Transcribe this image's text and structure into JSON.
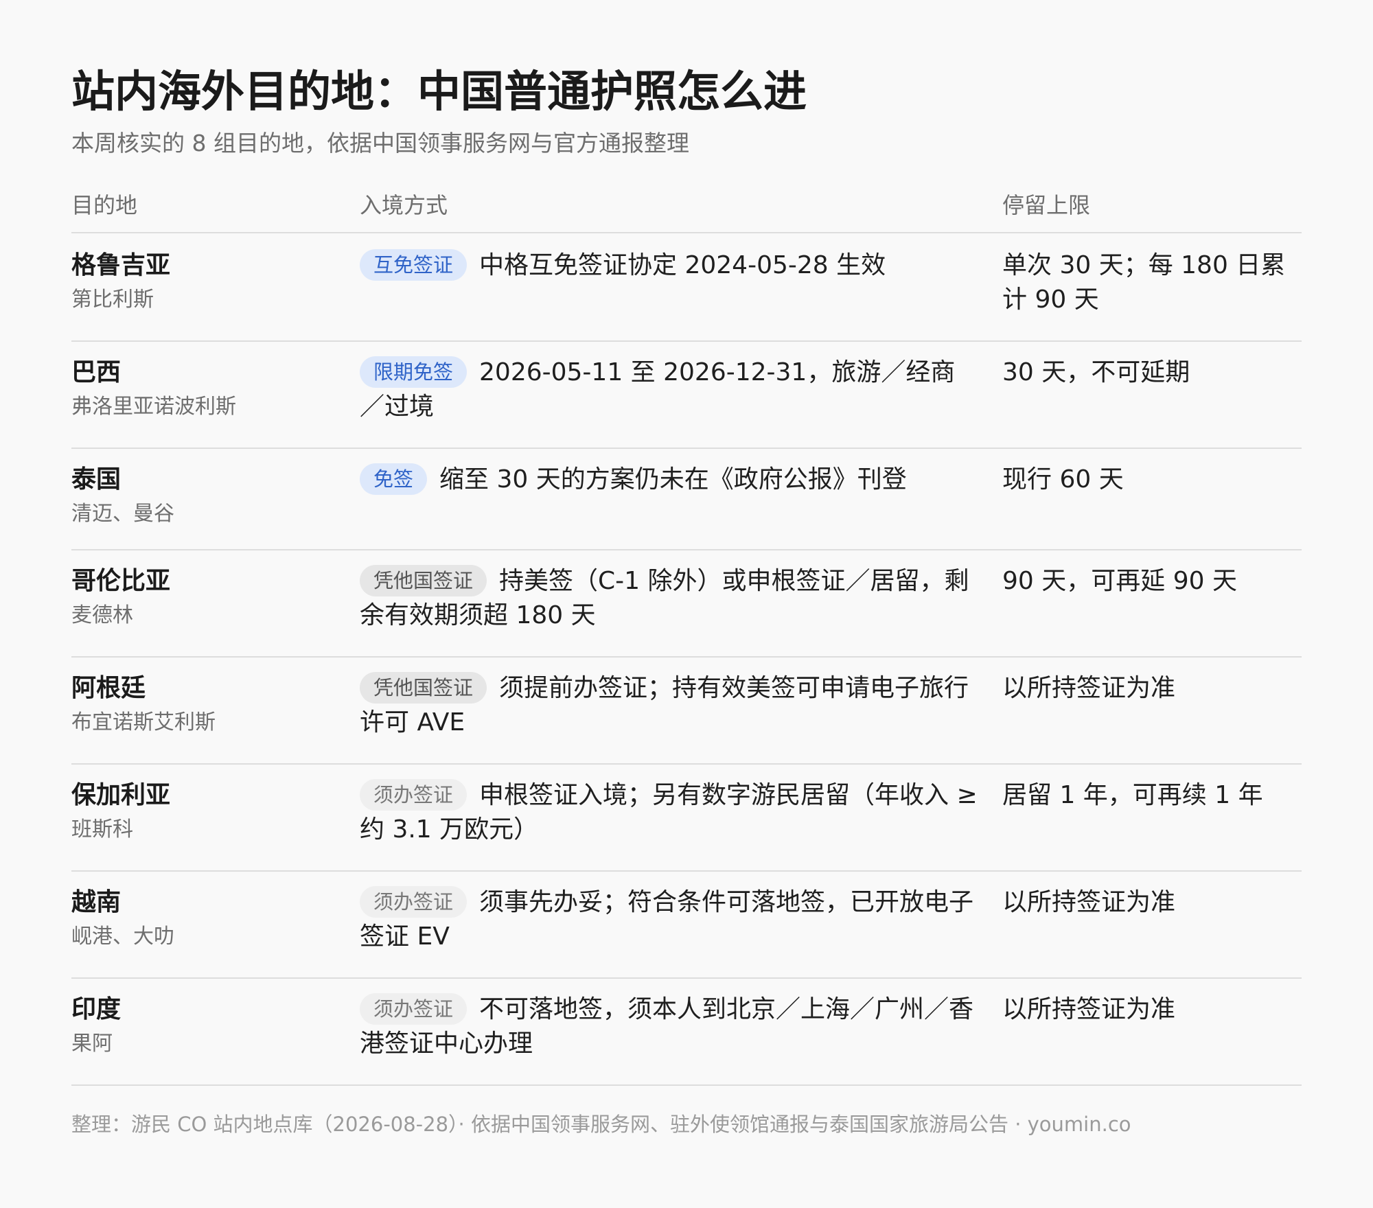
{
  "page": {
    "title": "站内海外目的地：中国普通护照怎么进",
    "subtitle": "本周核实的 8 组目的地，依据中国领事服务网与官方通报整理"
  },
  "table": {
    "headers": {
      "destination": "目的地",
      "entry": "入境方式",
      "stay": "停留上限"
    },
    "rows": [
      {
        "name": "格鲁吉亚",
        "city": "第比利斯",
        "badge": "互免签证",
        "badge_kind": "blue",
        "entry": "中格互免签证协定 2024-05-28 生效",
        "stay": "单次 30 天；每 180 日累计 90 天"
      },
      {
        "name": "巴西",
        "city": "弗洛里亚诺波利斯",
        "badge": "限期免签",
        "badge_kind": "blue",
        "entry": "2026-05-11 至 2026-12-31，旅游／经商／过境",
        "stay": "30 天，不可延期"
      },
      {
        "name": "泰国",
        "city": "清迈、曼谷",
        "badge": "免签",
        "badge_kind": "blue",
        "entry": "缩至 30 天的方案仍未在《政府公报》刊登",
        "stay": "现行 60 天"
      },
      {
        "name": "哥伦比亚",
        "city": "麦德林",
        "badge": "凭他国签证",
        "badge_kind": "gray",
        "entry": "持美签（C-1 除外）或申根签证／居留，剩余有效期须超 180 天",
        "stay": "90 天，可再延 90 天"
      },
      {
        "name": "阿根廷",
        "city": "布宜诺斯艾利斯",
        "badge": "凭他国签证",
        "badge_kind": "gray",
        "entry": "须提前办签证；持有效美签可申请电子旅行许可 AVE",
        "stay": "以所持签证为准"
      },
      {
        "name": "保加利亚",
        "city": "班斯科",
        "badge": "须办签证",
        "badge_kind": "light",
        "entry": "申根签证入境；另有数字游民居留（年收入 ≥ 约 3.1 万欧元）",
        "stay": "居留 1 年，可再续 1 年"
      },
      {
        "name": "越南",
        "city": "岘港、大叻",
        "badge": "须办签证",
        "badge_kind": "light",
        "entry": "须事先办妥；符合条件可落地签，已开放电子签证 EV",
        "stay": "以所持签证为准"
      },
      {
        "name": "印度",
        "city": "果阿",
        "badge": "须办签证",
        "badge_kind": "light",
        "entry": "不可落地签，须本人到北京／上海／广州／香港签证中心办理",
        "stay": "以所持签证为准"
      }
    ]
  },
  "footer": "整理：游民 CO 站内地点库（2026-08-28）· 依据中国领事服务网、驻外使领馆通报与泰国国家旅游局公告 · youmin.co",
  "colors": {
    "pill_blue_bg": "#dde8fb",
    "pill_blue_text": "#2f63c8",
    "pill_gray_bg": "#e6e6e6",
    "pill_gray_text": "#555555",
    "pill_light_bg": "#efefef",
    "pill_light_text": "#777777"
  }
}
